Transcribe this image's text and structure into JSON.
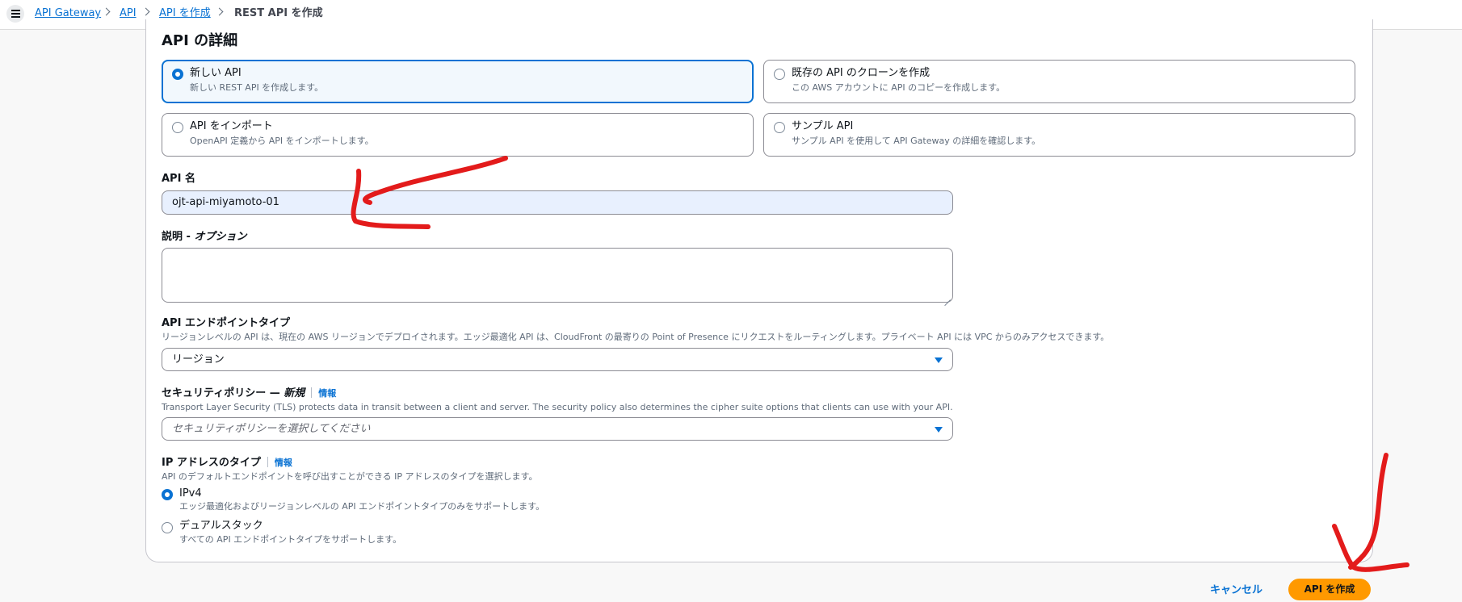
{
  "breadcrumb": {
    "items": [
      "API Gateway",
      "API",
      "API を作成"
    ],
    "current": "REST API を作成"
  },
  "section": {
    "title": "API の詳細"
  },
  "api_type_options": [
    {
      "title": "新しい API",
      "desc": "新しい REST API を作成します。",
      "selected": true
    },
    {
      "title": "既存の API のクローンを作成",
      "desc": "この AWS アカウントに API のコピーを作成します。",
      "selected": false
    },
    {
      "title": "API をインポート",
      "desc": "OpenAPI 定義から API をインポートします。",
      "selected": false
    },
    {
      "title": "サンプル API",
      "desc": "サンプル API を使用して API Gateway の詳細を確認します。",
      "selected": false
    }
  ],
  "api_name": {
    "label": "API 名",
    "value": "ojt-api-miyamoto-01"
  },
  "description": {
    "label": "説明",
    "optional": "オプション",
    "value": ""
  },
  "endpoint_type": {
    "label": "API エンドポイントタイプ",
    "hint": "リージョンレベルの API は、現在の AWS リージョンでデプロイされます。エッジ最適化 API は、CloudFront の最寄りの Point of Presence にリクエストをルーティングします。プライベート API には VPC からのみアクセスできます。",
    "value": "リージョン"
  },
  "security_policy": {
    "label": "セキュリティポリシー —",
    "tag": "新規",
    "info": "情報",
    "hint": "Transport Layer Security (TLS) protects data in transit between a client and server. The security policy also determines the cipher suite options that clients can use with your API.",
    "placeholder": "セキュリティポリシーを選択してください"
  },
  "ip_type": {
    "label": "IP アドレスのタイプ",
    "info": "情報",
    "hint": "API のデフォルトエンドポイントを呼び出すことができる IP アドレスのタイプを選択します。",
    "options": [
      {
        "title": "IPv4",
        "desc": "エッジ最適化およびリージョンレベルの API エンドポイントタイプのみをサポートします。",
        "selected": true
      },
      {
        "title": "デュアルスタック",
        "desc": "すべての API エンドポイントタイプをサポートします。",
        "selected": false
      }
    ]
  },
  "actions": {
    "cancel": "キャンセル",
    "create": "API を作成"
  },
  "colors": {
    "accent": "#0972d3",
    "primary_button": "#ff9900",
    "annotation": "#e31b1b"
  }
}
